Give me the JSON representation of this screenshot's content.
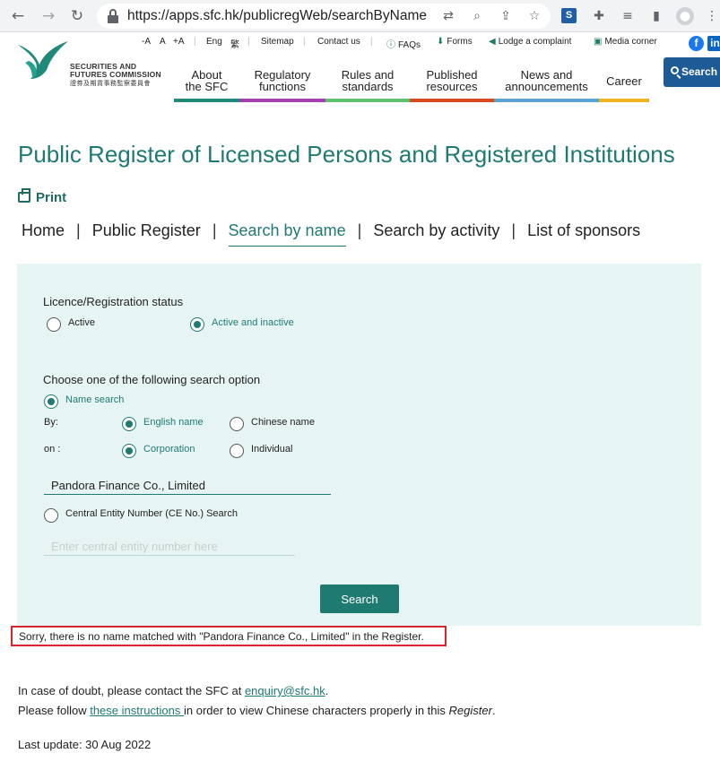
{
  "browser": {
    "url": "https://apps.sfc.hk/publicregWeb/searchByName"
  },
  "site": {
    "logo_line1": "SECURITIES AND",
    "logo_line2": "FUTURES COMMISSION",
    "logo_chinese": "證券及期貨事務監察委員會",
    "utility": {
      "font_minus": "-A",
      "font_normal": "A",
      "font_plus": "+A",
      "lang_eng": "Eng",
      "lang_chi": "繁",
      "sitemap": "Sitemap",
      "contact": "Contact us",
      "faqs": "FAQs",
      "forms": "Forms",
      "complaint": "Lodge a complaint",
      "media": "Media corner"
    },
    "nav": [
      {
        "line1": "About",
        "line2": "the SFC",
        "color": "#1f8a7a"
      },
      {
        "line1": "Regulatory",
        "line2": "functions",
        "color": "#a63fb0"
      },
      {
        "line1": "Rules and",
        "line2": "standards",
        "color": "#5fbf72"
      },
      {
        "line1": "Published",
        "line2": "resources",
        "color": "#d94a1e"
      },
      {
        "line1": "News and",
        "line2": "announcements",
        "color": "#5ba3d0"
      },
      {
        "line1": "Career",
        "line2": "",
        "color": "#f0b323"
      }
    ],
    "search_label": "Search"
  },
  "page": {
    "title": "Public Register of Licensed Persons and Registered Institutions",
    "print_label": "Print",
    "breadcrumb": {
      "home": "Home",
      "register": "Public Register",
      "by_name": "Search by name",
      "by_activity": "Search by activity",
      "sponsors": "List of sponsors"
    }
  },
  "form": {
    "status_label": "Licence/Registration status",
    "status_active": "Active",
    "status_active_inactive": "Active and inactive",
    "option_label": "Choose one of the following search option",
    "name_search": "Name search",
    "by_label": "By:",
    "english_name": "English name",
    "chinese_name": "Chinese name",
    "on_label": "on :",
    "corporation": "Corporation",
    "individual": "Individual",
    "name_value": "Pandora Finance Co., Limited",
    "ce_search": "Central Entity Number (CE No.) Search",
    "ce_placeholder": "Enter central entity number here",
    "search_button": "Search"
  },
  "result": {
    "error": "Sorry, there is no name matched with \"Pandora Finance Co., Limited\" in the Register."
  },
  "footer": {
    "doubt_prefix": "In case of doubt, please contact the SFC at ",
    "email": "enquiry@sfc.hk",
    "doubt_suffix": ".",
    "follow_prefix": "Please follow ",
    "instructions": "these instructions ",
    "follow_mid": "in order to view Chinese characters properly in this ",
    "register_word": "Register",
    "follow_suffix": ".",
    "last_update": "Last update: 30 Aug 2022"
  }
}
